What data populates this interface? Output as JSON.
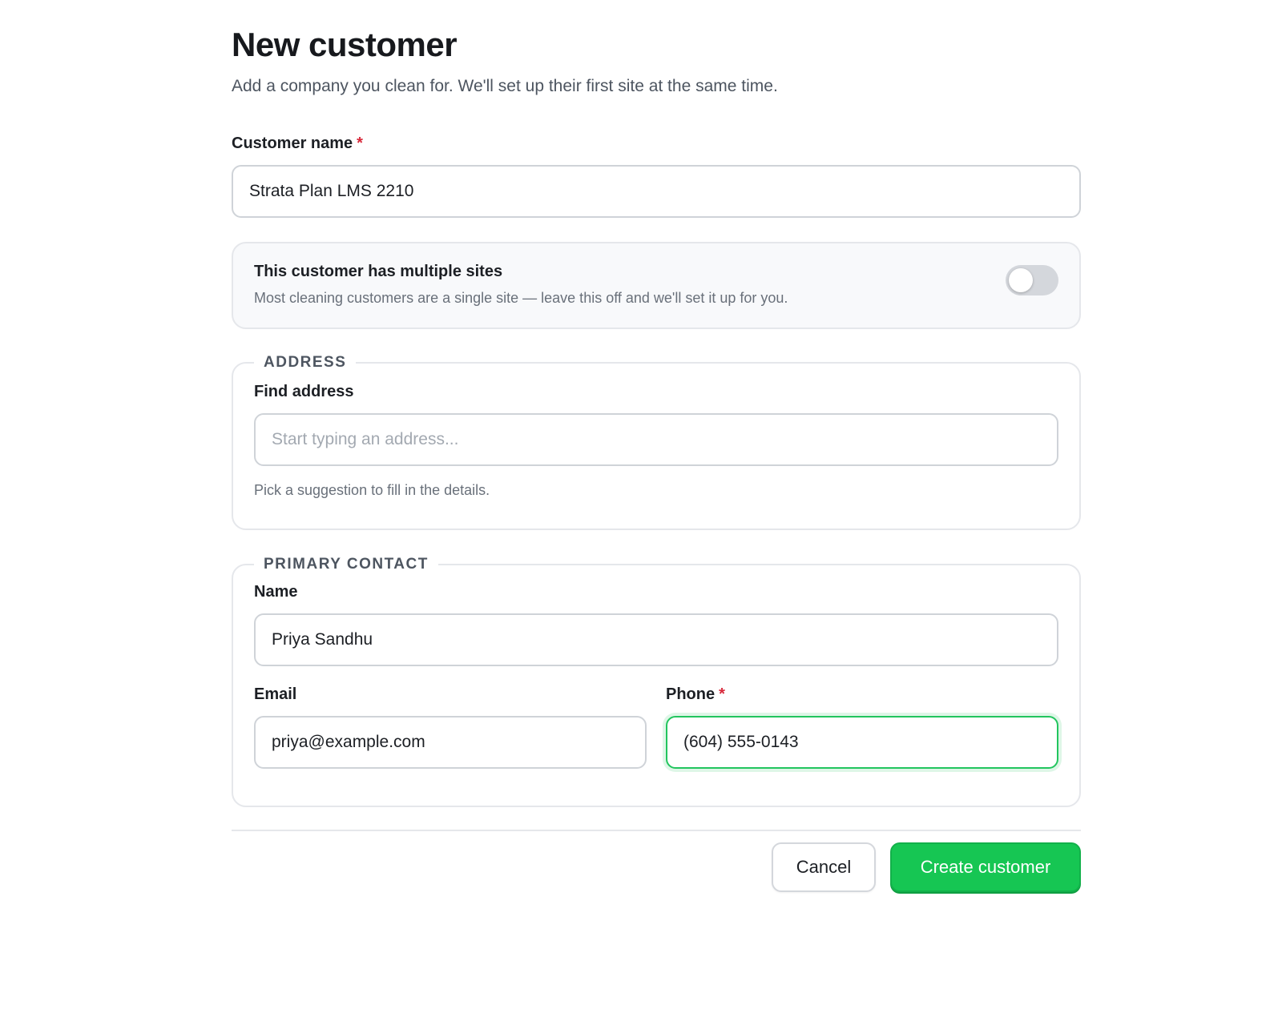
{
  "page": {
    "title": "New customer",
    "subtitle": "Add a company you clean for. We'll set up their first site at the same time."
  },
  "customer": {
    "label": "Customer name",
    "required_mark": "*",
    "value": "Strata Plan LMS 2210"
  },
  "multiple_sites": {
    "title": "This customer has multiple sites",
    "description": "Most cleaning customers are a single site — leave this off and we'll set it up for you.",
    "enabled": false
  },
  "address": {
    "legend": "ADDRESS",
    "find_label": "Find address",
    "placeholder": "Start typing an address...",
    "help": "Pick a suggestion to fill in the details."
  },
  "contact": {
    "legend": "PRIMARY CONTACT",
    "name_label": "Name",
    "name_value": "Priya Sandhu",
    "email_label": "Email",
    "email_value": "priya@example.com",
    "phone_label": "Phone",
    "phone_required_mark": "*",
    "phone_value": "(604) 555-0143"
  },
  "actions": {
    "cancel_label": "Cancel",
    "create_label": "Create customer"
  },
  "colors": {
    "accent": "#16c653",
    "required": "#d8283a",
    "focus_border": "#22c55e"
  }
}
